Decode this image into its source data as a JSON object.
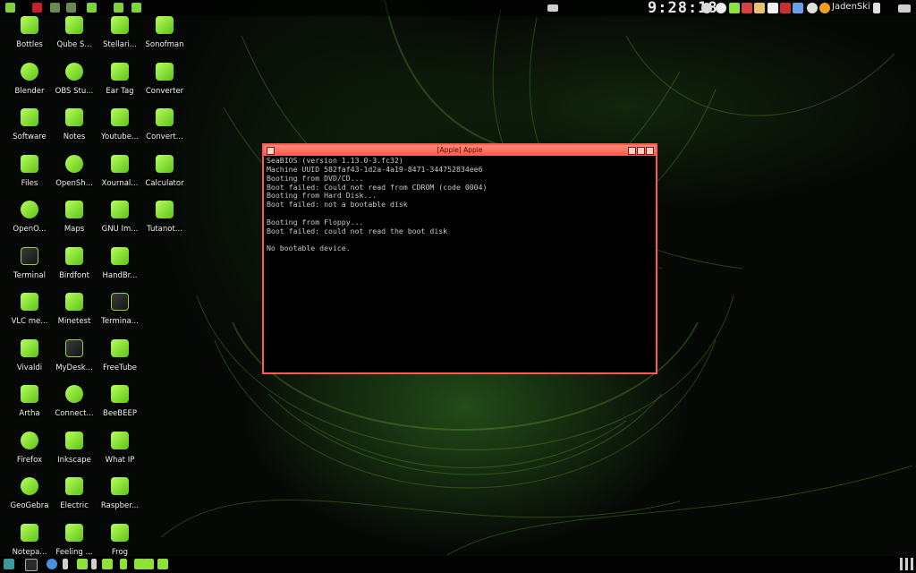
{
  "top_panel": {
    "clock": "9:28:18",
    "username": "JadenSki",
    "launchers": [
      "app-launcher-icon",
      "app-launcher-icon",
      "app-launcher-icon",
      "app-launcher-icon",
      "app-launcher-icon",
      "app-launcher-icon",
      "app-launcher-icon"
    ],
    "tray_icons": [
      "volume-icon",
      "close-circle-icon",
      "wifi-icon",
      "terminal-icon",
      "monitor-icon",
      "clipboard-icon",
      "box-icon",
      "snowflake-icon",
      "sun-icon"
    ]
  },
  "desktop_icons": [
    {
      "label": "Bottles",
      "icon": "bottle-icon"
    },
    {
      "label": "Blender",
      "icon": "blender-icon"
    },
    {
      "label": "Software",
      "icon": "software-icon"
    },
    {
      "label": "Files",
      "icon": "files-icon"
    },
    {
      "label": "OpenO...",
      "icon": "openoffice-icon"
    },
    {
      "label": "Terminal",
      "icon": "terminal-icon"
    },
    {
      "label": "VLC me...",
      "icon": "vlc-icon"
    },
    {
      "label": "Vivaldi",
      "icon": "vivaldi-icon"
    },
    {
      "label": "Artha",
      "icon": "artha-icon"
    },
    {
      "label": "Firefox",
      "icon": "firefox-icon"
    },
    {
      "label": "GeoGebra",
      "icon": "geogebra-icon"
    },
    {
      "label": "Notepa...",
      "icon": "notepad-icon"
    },
    {
      "label": "Qube S...",
      "icon": "qube-icon"
    },
    {
      "label": "OBS Stu...",
      "icon": "obs-icon"
    },
    {
      "label": "Notes",
      "icon": "notes-icon"
    },
    {
      "label": "OpenSh...",
      "icon": "openshot-icon"
    },
    {
      "label": "Maps",
      "icon": "maps-icon"
    },
    {
      "label": "Birdfont",
      "icon": "birdfont-icon"
    },
    {
      "label": "Minetest",
      "icon": "minetest-icon"
    },
    {
      "label": "MyDesk...",
      "icon": "mydesk-icon"
    },
    {
      "label": "Connect...",
      "icon": "connect-icon"
    },
    {
      "label": "Inkscape",
      "icon": "inkscape-icon"
    },
    {
      "label": "Electric",
      "icon": "electric-icon"
    },
    {
      "label": "Feeling ...",
      "icon": "feeling-icon"
    },
    {
      "label": "Stellari...",
      "icon": "stellarium-icon"
    },
    {
      "label": "Ear Tag",
      "icon": "eartag-icon"
    },
    {
      "label": "Youtube...",
      "icon": "youtube-icon"
    },
    {
      "label": "Xournal...",
      "icon": "xournal-icon"
    },
    {
      "label": "GNU Im...",
      "icon": "gimp-icon"
    },
    {
      "label": "HandBr...",
      "icon": "handbrake-icon"
    },
    {
      "label": "Termina...",
      "icon": "terminal-icon"
    },
    {
      "label": "FreeTube",
      "icon": "freetube-icon"
    },
    {
      "label": "BeeBEEP",
      "icon": "beebeep-icon"
    },
    {
      "label": "What IP",
      "icon": "whatip-icon"
    },
    {
      "label": "Raspber...",
      "icon": "raspberry-icon"
    },
    {
      "label": "Frog",
      "icon": "frog-icon"
    },
    {
      "label": "Sonofman",
      "icon": "sonofman-icon"
    },
    {
      "label": "Converter",
      "icon": "converter-icon"
    },
    {
      "label": "Convert...",
      "icon": "convert-icon"
    },
    {
      "label": "Calculator",
      "icon": "calculator-icon"
    },
    {
      "label": "Tutanot...",
      "icon": "tutanota-icon"
    }
  ],
  "vm_window": {
    "title": "[Apple] Apple",
    "lines": [
      "SeaBIOS (version 1.13.0-3.fc32)",
      "Machine UUID 582faf43-1d2a-4a19-8471-344752834ee6",
      "Booting from DVD/CD...",
      "Boot failed: Could not read from CDROM (code 0004)",
      "Booting from Hard Disk...",
      "Boot failed: not a bootable disk",
      "",
      "Booting from Floppy...",
      "Boot failed: could not read the boot disk",
      "",
      "No bootable device."
    ]
  },
  "bottom_panel": {
    "items": [
      "menu-icon",
      "terminal-icon",
      "search-icon",
      "chevron-up-icon",
      "app-icon",
      "chevron-up-icon",
      "vivaldi-icon",
      "calculator-icon",
      "grid-icon",
      "book-icon",
      "flask-icon"
    ]
  },
  "colors": {
    "accent": "#8fe03a",
    "window_border": "#ff5a4a",
    "terminal_text": "#c8c8c8"
  }
}
